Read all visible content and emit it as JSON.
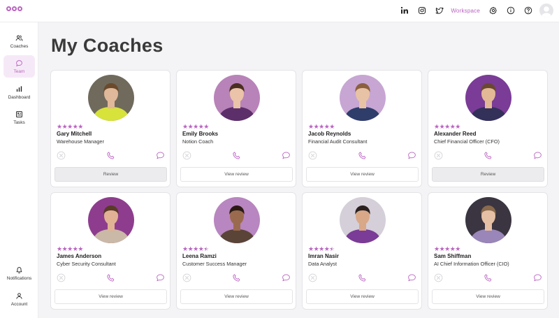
{
  "topbar": {
    "workspace_label": "Workspace",
    "icons": [
      "linkedin-icon",
      "instagram-icon",
      "twitter-icon",
      "gear-icon",
      "info-icon",
      "help-icon",
      "user-avatar"
    ]
  },
  "sidebar": {
    "items": [
      {
        "label": "Coaches",
        "icon": "users-icon",
        "active": false
      },
      {
        "label": "Team",
        "icon": "chat-bubble-icon",
        "active": true
      },
      {
        "label": "Dashboard",
        "icon": "bar-chart-icon",
        "active": false
      },
      {
        "label": "Tasks",
        "icon": "tasks-icon",
        "active": false
      },
      {
        "label": "Notifications",
        "icon": "bell-icon",
        "active": false
      },
      {
        "label": "Account",
        "icon": "user-icon",
        "active": false
      }
    ]
  },
  "page": {
    "title": "My Coaches"
  },
  "colors": {
    "accent": "#b964c0",
    "active_bg": "#f6e9f7"
  },
  "coaches": [
    {
      "name": "Gary Mitchell",
      "role": "Warehouse Manager",
      "rating": 5,
      "button": "Review",
      "button_filled": true,
      "bg": "#6f6a5c",
      "skin": "#e0b89a",
      "hair": "#6b4a2c",
      "shirt": "#d7e23a"
    },
    {
      "name": "Emily Brooks",
      "role": "Notion Coach",
      "rating": 5,
      "button": "View review",
      "button_filled": false,
      "bg": "#b883b8",
      "skin": "#eac3a8",
      "hair": "#4a2e22",
      "shirt": "#5c2f6b"
    },
    {
      "name": "Jacob Reynolds",
      "role": " Financial Audit Consultant",
      "rating": 5,
      "button": "View review",
      "button_filled": false,
      "bg": "#c7a6d3",
      "skin": "#e8c2a4",
      "hair": "#8b6040",
      "shirt": "#2f3d6b"
    },
    {
      "name": "Alexander Reed",
      "role": "Chief Financial Officer (CFO)",
      "rating": 5,
      "button": "Review",
      "button_filled": true,
      "bg": "#7a3c96",
      "skin": "#e2b896",
      "hair": "#6a4830",
      "shirt": "#33305a"
    },
    {
      "name": "James Anderson",
      "role": "Cyber Security Consultant",
      "rating": 5,
      "button": "View review",
      "button_filled": false,
      "bg": "#8e3d8e",
      "skin": "#e1b294",
      "hair": "#5a3a28",
      "shirt": "#c9b9a6"
    },
    {
      "name": "Leena Ramzi",
      "role": "Customer Success Manager",
      "rating": 4.5,
      "button": "View review",
      "button_filled": false,
      "bg": "#b886c0",
      "skin": "#9a6a4e",
      "hair": "#2a1a14",
      "shirt": "#5a4438"
    },
    {
      "name": "Imran Nasir",
      "role": "Data Analyst",
      "rating": 4.5,
      "button": "View review",
      "button_filled": false,
      "bg": "#d4cfd8",
      "skin": "#d8a888",
      "hair": "#2a2020",
      "shirt": "#7a3c96"
    },
    {
      "name": "Sam Shiffman",
      "role": "AI Chief Information Officer (CIO)",
      "rating": 5,
      "button": "View review",
      "button_filled": false,
      "bg": "#3a3540",
      "skin": "#e6c0a4",
      "hair": "#8a6a4c",
      "shirt": "#9a86b8"
    }
  ]
}
